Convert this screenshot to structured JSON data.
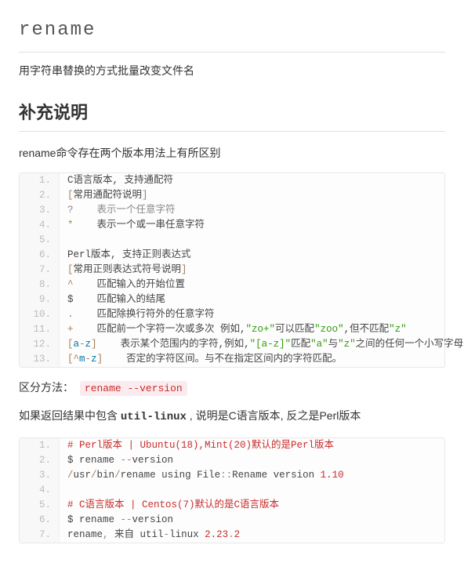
{
  "title": "rename",
  "subtitle": "用字符串替换的方式批量改变文件名",
  "section_heading": "补充说明",
  "intro": "rename命令存在两个版本用法上有所区别",
  "code1": {
    "lines": [
      {
        "n": "1.",
        "segs": [
          {
            "t": "C语言版本, 支持通配符"
          }
        ]
      },
      {
        "n": "2.",
        "segs": [
          {
            "t": "[",
            "c": "tok-op"
          },
          {
            "t": "常用通配符说明"
          },
          {
            "t": "]",
            "c": "tok-op"
          }
        ]
      },
      {
        "n": "3.",
        "segs": [
          {
            "t": "?    表示一个任意字符",
            "c": "tok-gray"
          }
        ]
      },
      {
        "n": "4.",
        "segs": [
          {
            "t": "*",
            "c": "tok-op"
          },
          {
            "t": "    表示一个或一串任意字符"
          }
        ]
      },
      {
        "n": "5.",
        "segs": []
      },
      {
        "n": "6.",
        "segs": [
          {
            "t": "Perl版本, 支持正则表达式"
          }
        ]
      },
      {
        "n": "7.",
        "segs": [
          {
            "t": "[",
            "c": "tok-op"
          },
          {
            "t": "常用正则表达式符号说明"
          },
          {
            "t": "]",
            "c": "tok-op"
          }
        ]
      },
      {
        "n": "8.",
        "segs": [
          {
            "t": "^",
            "c": "tok-op"
          },
          {
            "t": "    匹配输入的开始位置"
          }
        ]
      },
      {
        "n": "9.",
        "segs": [
          {
            "t": "$"
          },
          {
            "t": "    匹配输入的结尾"
          }
        ]
      },
      {
        "n": "10.",
        "segs": [
          {
            "t": ".",
            "c": "tok-op"
          },
          {
            "t": "    匹配除换行符外的任意字符"
          }
        ]
      },
      {
        "n": "11.",
        "segs": [
          {
            "t": "+",
            "c": "tok-op"
          },
          {
            "t": "    匹配前一个字符一次或多次 例如,"
          },
          {
            "t": "\"zo+\"",
            "c": "tok-green"
          },
          {
            "t": "可以匹配"
          },
          {
            "t": "\"zoo\"",
            "c": "tok-green"
          },
          {
            "t": ",但不匹配"
          },
          {
            "t": "\"z\"",
            "c": "tok-green"
          }
        ]
      },
      {
        "n": "12.",
        "segs": [
          {
            "t": "[",
            "c": "tok-op"
          },
          {
            "t": "a",
            "c": "tok-key"
          },
          {
            "t": "-",
            "c": "tok-op"
          },
          {
            "t": "z",
            "c": "tok-key"
          },
          {
            "t": "]",
            "c": "tok-op"
          },
          {
            "t": "    表示某个范围内的字符,例如,"
          },
          {
            "t": "\"[a-z]\"",
            "c": "tok-green"
          },
          {
            "t": "匹配"
          },
          {
            "t": "\"a\"",
            "c": "tok-green"
          },
          {
            "t": "与"
          },
          {
            "t": "\"z\"",
            "c": "tok-green"
          },
          {
            "t": "之间的任何一个小写字母字符。"
          }
        ]
      },
      {
        "n": "13.",
        "segs": [
          {
            "t": "[",
            "c": "tok-op"
          },
          {
            "t": "^",
            "c": "tok-op"
          },
          {
            "t": "m",
            "c": "tok-key"
          },
          {
            "t": "-",
            "c": "tok-op"
          },
          {
            "t": "z",
            "c": "tok-key"
          },
          {
            "t": "]",
            "c": "tok-op"
          },
          {
            "t": "    否定的字符区间。与不在指定区间内的字符匹配。"
          }
        ]
      }
    ]
  },
  "distinguish_label": "区分方法：",
  "distinguish_cmd": "rename --version",
  "result_prefix": "如果返回结果中包含 ",
  "result_mono": "util-linux",
  "result_suffix": " , 说明是C语言版本, 反之是Perl版本",
  "code2": {
    "lines": [
      {
        "n": "1.",
        "segs": [
          {
            "t": "# Perl版本 | Ubuntu(18),Mint(20)默认的是Perl版本",
            "c": "tok-red"
          }
        ]
      },
      {
        "n": "2.",
        "segs": [
          {
            "t": "$ rename "
          },
          {
            "t": "--",
            "c": "tok-op"
          },
          {
            "t": "version"
          }
        ]
      },
      {
        "n": "3.",
        "segs": [
          {
            "t": "/",
            "c": "tok-op"
          },
          {
            "t": "usr"
          },
          {
            "t": "/",
            "c": "tok-op"
          },
          {
            "t": "bin"
          },
          {
            "t": "/",
            "c": "tok-op"
          },
          {
            "t": "rename using File"
          },
          {
            "t": "::",
            "c": "tok-op"
          },
          {
            "t": "Rename version "
          },
          {
            "t": "1.10",
            "c": "tok-num"
          }
        ]
      },
      {
        "n": "4.",
        "segs": []
      },
      {
        "n": "5.",
        "segs": [
          {
            "t": "# C语言版本 | Centos(7)默认的是C语言版本",
            "c": "tok-red"
          }
        ]
      },
      {
        "n": "6.",
        "segs": [
          {
            "t": "$ rename "
          },
          {
            "t": "--",
            "c": "tok-op"
          },
          {
            "t": "version"
          }
        ]
      },
      {
        "n": "7.",
        "segs": [
          {
            "t": "rename"
          },
          {
            "t": ",",
            "c": "tok-op"
          },
          {
            "t": " 来自 util"
          },
          {
            "t": "-",
            "c": "tok-op"
          },
          {
            "t": "linux "
          },
          {
            "t": "2.23",
            "c": "tok-num"
          },
          {
            "t": ".",
            "c": "tok-op"
          },
          {
            "t": "2",
            "c": "tok-num"
          }
        ]
      }
    ]
  }
}
